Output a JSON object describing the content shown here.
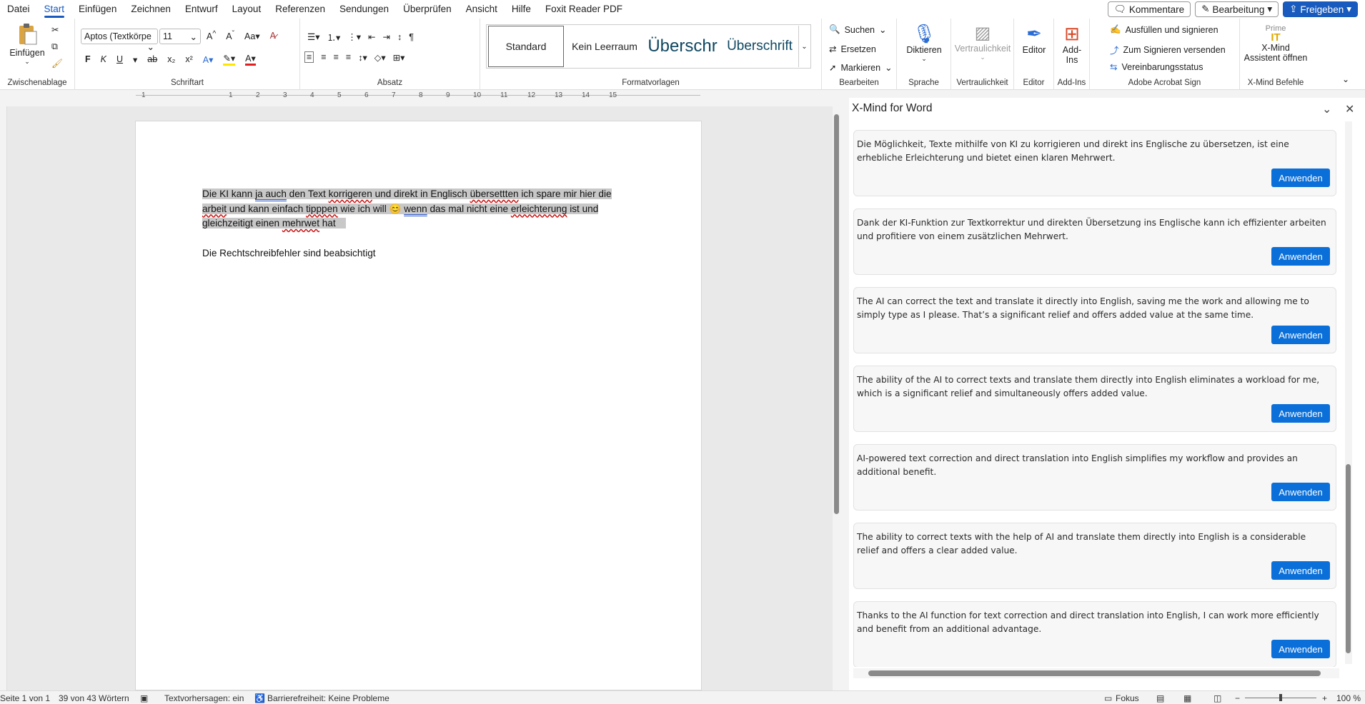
{
  "menu": [
    "Datei",
    "Start",
    "Einfügen",
    "Zeichnen",
    "Entwurf",
    "Layout",
    "Referenzen",
    "Sendungen",
    "Überprüfen",
    "Ansicht",
    "Hilfe",
    "Foxit Reader PDF"
  ],
  "topright": {
    "comments": "Kommentare",
    "edit": "Bearbeitung",
    "share": "Freigeben"
  },
  "ribbon": {
    "clipboard": {
      "paste": "Einfügen",
      "label": "Zwischenablage"
    },
    "font": {
      "name": "Aptos (Textkörpe",
      "size": "11",
      "label": "Schriftart",
      "bold": "F",
      "italic": "K",
      "underline": "U",
      "case": "Aa"
    },
    "paragraph": {
      "label": "Absatz"
    },
    "styles": {
      "items": [
        "Standard",
        "Kein Leerraum",
        "Überschr",
        "Überschrift"
      ],
      "label": "Formatvorlagen"
    },
    "editing": {
      "find": "Suchen",
      "replace": "Ersetzen",
      "select": "Markieren",
      "label": "Bearbeiten"
    },
    "voice": {
      "dictate": "Diktieren",
      "label": "Sprache"
    },
    "sensitivity": {
      "btn": "Vertraulichkeit",
      "label": "Vertraulichkeit"
    },
    "editor": {
      "btn": "Editor",
      "label": "Editor"
    },
    "addins": {
      "btn": "Add-Ins",
      "label": "Add-Ins"
    },
    "acrobat": {
      "fill": "Ausfüllen und signieren",
      "send": "Zum Signieren versenden",
      "status": "Vereinbarungsstatus",
      "label": "Adobe Acrobat Sign"
    },
    "xmind": {
      "top": "Prime",
      "btn1": "X-Mind",
      "btn2": "Assistent öffnen",
      "label": "X-Mind Befehle"
    }
  },
  "ruler": [
    "1",
    "1",
    "2",
    "3",
    "4",
    "5",
    "6",
    "7",
    "8",
    "9",
    "10",
    "11",
    "12",
    "13",
    "14",
    "15"
  ],
  "document": {
    "p1_a": "Die KI kann ",
    "p1_b": "ja auch",
    "p1_c": " den Text ",
    "p1_d": "korrigeren",
    "p1_e": " und direkt in Englisch ",
    "p1_f": "übersettten",
    "p1_g": " ich spare mir hier die",
    "p2_a": "arbeit",
    "p2_b": " und kann einfach ",
    "p2_c": "tipppen",
    "p2_d": " wie ich will ",
    "p2_emoji": "😊",
    "p2_e": "wenn",
    "p2_f": " das mal nicht eine ",
    "p2_g": "erleichterung",
    "p2_h": " ist und",
    "p3_a": "gleichzeitigt einen ",
    "p3_b": "mehrwet",
    "p3_c": " hat",
    "note": "Die Rechtschreibfehler sind beabsichtigt"
  },
  "pane": {
    "title": "X-Mind for Word",
    "apply_label": "Anwenden",
    "suggestions": [
      "Die Möglichkeit, Texte mithilfe von KI zu korrigieren und direkt ins Englische zu übersetzen, ist eine erhebliche Erleichterung und bietet einen klaren Mehrwert.",
      "Dank der KI-Funktion zur Textkorrektur und direkten Übersetzung ins Englische kann ich effizienter arbeiten und profitiere von einem zusätzlichen Mehrwert.",
      "The AI can correct the text and translate it directly into English, saving me the work and allowing me to simply type as I please. That’s a significant relief and offers added value at the same time.",
      "The ability of the AI to correct texts and translate them directly into English eliminates a workload for me, which is a significant relief and simultaneously offers added value.",
      "AI-powered text correction and direct translation into English simplifies my workflow and provides an additional benefit.",
      "The ability to correct texts with the help of AI and translate them directly into English is a considerable relief and offers a clear added value.",
      "Thanks to the AI function for text correction and direct translation into English, I can work more efficiently and benefit from an additional advantage."
    ]
  },
  "status": {
    "page": "Seite 1 von 1",
    "words": "39 von 43 Wörtern",
    "predict": "Textvorhersagen: ein",
    "access": "Barrierefreiheit: Keine Probleme",
    "focus": "Fokus",
    "zoom": "100 %"
  }
}
